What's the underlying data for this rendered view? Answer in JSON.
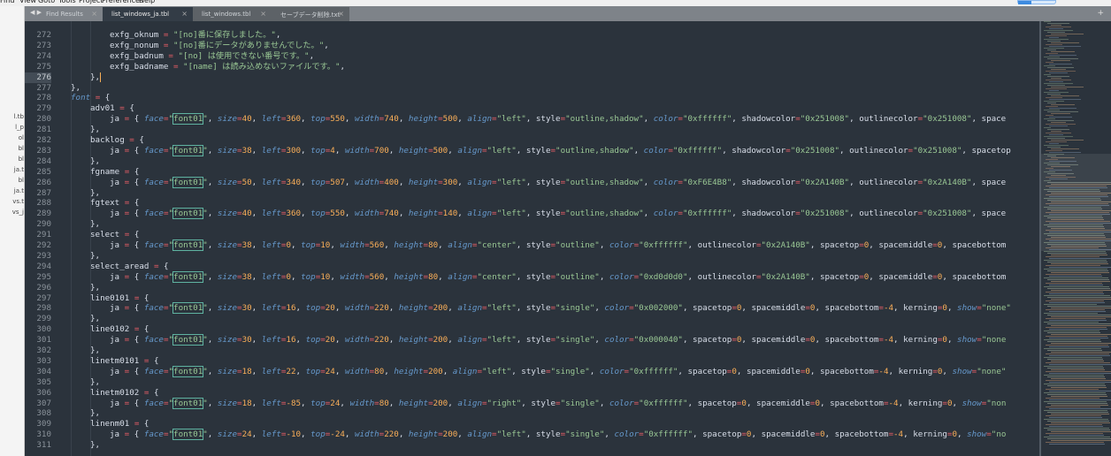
{
  "menu": [
    "Find",
    "View",
    "Goto",
    "Tools",
    "Project",
    "Preferences",
    "Help"
  ],
  "sidebar_files": [
    "l.tb",
    "l_p",
    "ol",
    "bl",
    "bl",
    "ja.t",
    "bl",
    "ja.t",
    "vs.t",
    "vs_j"
  ],
  "tabs": [
    {
      "label": "Find Results",
      "active": false
    },
    {
      "label": "list_windows_ja.tbl",
      "active": true
    },
    {
      "label": "list_windows.tbl",
      "active": false
    },
    {
      "label": "セーブデータ削除.txt",
      "active": false
    }
  ],
  "editor": {
    "current_line": 276,
    "lines": [
      {
        "n": 272,
        "indent": 3,
        "text": "exfg_oknum = \"[no]番に保存しました。\","
      },
      {
        "n": 273,
        "indent": 3,
        "text": "exfg_nonum = \"[no]番にデータがありませんでした。\","
      },
      {
        "n": 274,
        "indent": 3,
        "text": "exfg_badnum = \"[no] は使用できない番号です。\","
      },
      {
        "n": 275,
        "indent": 3,
        "text": "exfg_badname = \"[name] は読み込めないファイルです。\","
      },
      {
        "n": 276,
        "indent": 2,
        "text": "},"
      },
      {
        "n": 277,
        "indent": 1,
        "text": "},"
      },
      {
        "n": 278,
        "indent": 1,
        "text": "font = {"
      },
      {
        "n": 279,
        "indent": 2,
        "text": "adv01 = {"
      },
      {
        "n": 280,
        "indent": 3,
        "text": "ja = { face=\"font01\", size=40, left=360, top=550, width=740, height=500, align=\"left\", style=\"outline,shadow\", color=\"0xffffff\", shadowcolor=\"0x251008\", outlinecolor=\"0x251008\", space"
      },
      {
        "n": 281,
        "indent": 2,
        "text": "},"
      },
      {
        "n": 282,
        "indent": 2,
        "text": "backlog = {"
      },
      {
        "n": 283,
        "indent": 3,
        "text": "ja = { face=\"font01\", size=38, left=300, top=4, width=700, height=500, align=\"left\", style=\"outline,shadow\", color=\"0xffffff\", shadowcolor=\"0x251008\", outlinecolor=\"0x251008\", spacetop"
      },
      {
        "n": 284,
        "indent": 2,
        "text": "},"
      },
      {
        "n": 285,
        "indent": 2,
        "text": "fgname = {"
      },
      {
        "n": 286,
        "indent": 3,
        "text": "ja = { face=\"font01\", size=50, left=340, top=507, width=400, height=300, align=\"left\", style=\"outline,shadow\", color=\"0xF6E4B8\", shadowcolor=\"0x2A140B\", outlinecolor=\"0x2A140B\", space"
      },
      {
        "n": 287,
        "indent": 2,
        "text": "},"
      },
      {
        "n": 288,
        "indent": 2,
        "text": "fgtext = {"
      },
      {
        "n": 289,
        "indent": 3,
        "text": "ja = { face=\"font01\", size=40, left=360, top=550, width=740, height=140, align=\"left\", style=\"outline,shadow\", color=\"0xffffff\", shadowcolor=\"0x251008\", outlinecolor=\"0x251008\", space"
      },
      {
        "n": 290,
        "indent": 2,
        "text": "},"
      },
      {
        "n": 291,
        "indent": 2,
        "text": "select = {"
      },
      {
        "n": 292,
        "indent": 3,
        "text": "ja = { face=\"font01\", size=38, left=0, top=10, width=560, height=80, align=\"center\", style=\"outline\", color=\"0xffffff\", outlinecolor=\"0x2A140B\", spacetop=0, spacemiddle=0, spacebottom"
      },
      {
        "n": 293,
        "indent": 2,
        "text": "},"
      },
      {
        "n": 294,
        "indent": 2,
        "text": "select_aread = {"
      },
      {
        "n": 295,
        "indent": 3,
        "text": "ja = { face=\"font01\", size=38, left=0, top=10, width=560, height=80, align=\"center\", style=\"outline\", color=\"0xd0d0d0\", outlinecolor=\"0x2A140B\", spacetop=0, spacemiddle=0, spacebottom"
      },
      {
        "n": 296,
        "indent": 2,
        "text": "},"
      },
      {
        "n": 297,
        "indent": 2,
        "text": "line0101 = {"
      },
      {
        "n": 298,
        "indent": 3,
        "text": "ja = { face=\"font01\", size=30, left=16, top=20, width=220, height=200, align=\"left\", style=\"single\", color=\"0x002000\", spacetop=0, spacemiddle=0, spacebottom=-4, kerning=0, show=\"none\""
      },
      {
        "n": 299,
        "indent": 2,
        "text": "},"
      },
      {
        "n": 300,
        "indent": 2,
        "text": "line0102 = {"
      },
      {
        "n": 301,
        "indent": 3,
        "text": "ja = { face=\"font01\", size=30, left=16, top=20, width=220, height=200, align=\"left\", style=\"single\", color=\"0x000040\", spacetop=0, spacemiddle=0, spacebottom=-4, kerning=0, show=\"none"
      },
      {
        "n": 302,
        "indent": 2,
        "text": "},"
      },
      {
        "n": 303,
        "indent": 2,
        "text": "linetm0101 = {"
      },
      {
        "n": 304,
        "indent": 3,
        "text": "ja = { face=\"font01\", size=18, left=22, top=24, width=80, height=200, align=\"left\", style=\"single\", color=\"0xffffff\", spacetop=0, spacemiddle=0, spacebottom=-4, kerning=0, show=\"none\""
      },
      {
        "n": 305,
        "indent": 2,
        "text": "},"
      },
      {
        "n": 306,
        "indent": 2,
        "text": "linetm0102 = {"
      },
      {
        "n": 307,
        "indent": 3,
        "text": "ja = { face=\"font01\", size=18, left=-85, top=24, width=80, height=200, align=\"right\", style=\"single\", color=\"0xffffff\", spacetop=0, spacemiddle=0, spacebottom=-4, kerning=0, show=\"non"
      },
      {
        "n": 308,
        "indent": 2,
        "text": "},"
      },
      {
        "n": 309,
        "indent": 2,
        "text": "linenm01 = {"
      },
      {
        "n": 310,
        "indent": 3,
        "text": "ja = { face=\"font01\", size=24, left=-10, top=-24, width=220, height=200, align=\"left\", style=\"single\", color=\"0xffffff\", spacetop=0, spacemiddle=0, spacebottom=-4, kerning=0, show=\"no"
      },
      {
        "n": 311,
        "indent": 2,
        "text": "},"
      }
    ]
  },
  "colors": {
    "background": "#2b333c",
    "string": "#99c794",
    "number": "#f9ae58",
    "operator": "#ec5f67",
    "keyword": "#6699cc"
  }
}
